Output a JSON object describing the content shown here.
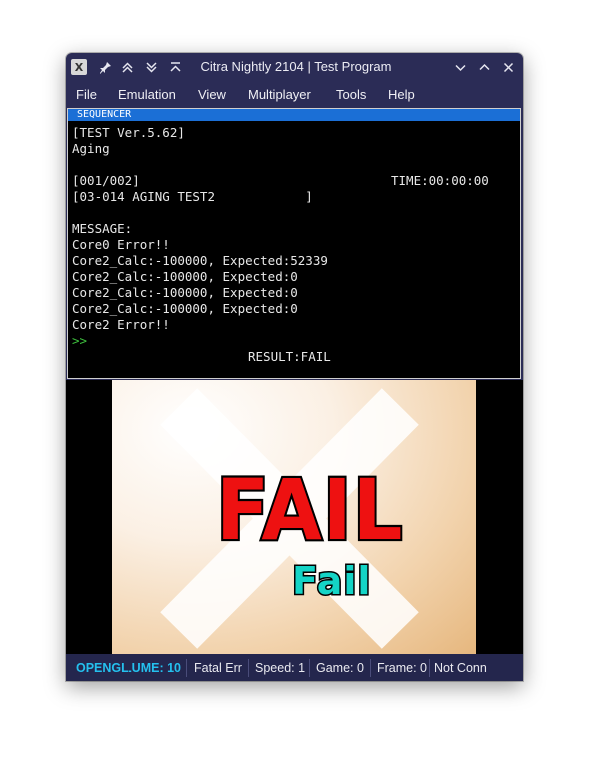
{
  "window": {
    "title": "Citra Nightly 2104 | Test Program",
    "app_icon_glyph": "X"
  },
  "menu": {
    "items": [
      "File",
      "Emulation",
      "View",
      "Multiplayer",
      "Tools",
      "Help"
    ]
  },
  "top_screen": {
    "header": "SEQUENCER",
    "lines": [
      "[TEST Ver.5.62]",
      "Aging",
      "",
      "[001/002]",
      "[03-014 AGING TEST2            ]",
      "",
      "MESSAGE:",
      "Core0 Error!!",
      "Core2_Calc:-100000, Expected:52339",
      "Core2_Calc:-100000, Expected:0",
      "Core2_Calc:-100000, Expected:0",
      "Core2_Calc:-100000, Expected:0",
      "Core2 Error!!"
    ],
    "time": "TIME:00:00:00",
    "prompt": ">>",
    "result": "RESULT:FAIL"
  },
  "bottom_screen": {
    "big_text": "FAIL",
    "small_text": "Fail"
  },
  "status_bar": {
    "renderer": "OPENGL",
    "volume": "VOLUME: 10",
    "fatal": "Fatal Error",
    "speed": "Speed: 1",
    "game": "Game: 0",
    "frame": "Frame: 0",
    "network": "Not Conn"
  },
  "colors": {
    "window_bg": "#2b2c56",
    "sequencer_bar": "#1b6fd6",
    "fail_red": "#ee1111",
    "fail_cyan": "#14d4c6",
    "opengl_blue": "#24c0ee",
    "prompt_green": "#3ec13e"
  }
}
